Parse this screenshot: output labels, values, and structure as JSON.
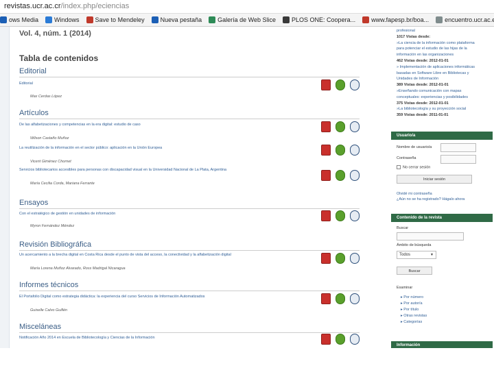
{
  "browser": {
    "url_host": "revistas.ucr.ac.cr",
    "url_path": "/index.php/eciencias",
    "bookmarks": [
      {
        "label": "ows Media",
        "color": "#1c5fb5"
      },
      {
        "label": "Windows",
        "color": "#2b7bd6"
      },
      {
        "label": "Save to Mendeley",
        "color": "#c0392b"
      },
      {
        "label": "Nueva pestaña",
        "color": "#1c5fb5"
      },
      {
        "label": "Galería de Web Slice",
        "color": "#2e8b57"
      },
      {
        "label": "PLOS ONE: Coopera...",
        "color": "#3a3a3a"
      },
      {
        "label": "www.fapesp.br/boa...",
        "color": "#c0392b"
      },
      {
        "label": "encuentro.ucr.ac.ed...",
        "color": "#7f8c8d"
      }
    ]
  },
  "issue": {
    "volume": "Vol. 4, núm. 1 (2014)",
    "toc_title": "Tabla de contenidos"
  },
  "sections": [
    {
      "title": "Editorial",
      "articles": [
        {
          "title": "Editorial",
          "authors": "Max Cerdas López"
        }
      ]
    },
    {
      "title": "Artículos",
      "articles": [
        {
          "title": "De las alfabetizaciones y competencias en la era digital: estudio de caso",
          "authors": "Wilson Castaño Muñoz"
        },
        {
          "title": "La reutilización de la información en el sector público: aplicación en la Unión Europea",
          "authors": "Vicent Giménez Chornet"
        },
        {
          "title": "Servicios bibliotecarios accesibles para personas con discapacidad visual en la Universidad Nacional de La Plata, Argentina",
          "authors": "María Cecilia Corda, Mariana Ferrante"
        }
      ]
    },
    {
      "title": "Ensayos",
      "articles": [
        {
          "title": "Con el estratégico de gestión en unidades de información",
          "authors": "Myron Fernández Méndez"
        }
      ]
    },
    {
      "title": "Revisión Bibliográfica",
      "articles": [
        {
          "title": "Un acercamiento a la brecha digital en Costa Rica desde el punto de vista del acceso, la conectividad y la alfabetización digital",
          "authors": "María Lorena Muñoz Alvarado, Ross Madrigal Nicaragua"
        }
      ]
    },
    {
      "title": "Informes técnicos",
      "articles": [
        {
          "title": "El Portafolio Digital como estrategia didáctica: la experiencia del curso Servicios de Información Automatizados",
          "authors": "Guiselle Calvo Guillén"
        }
      ]
    },
    {
      "title": "Misceláneas",
      "articles": [
        {
          "title": "Notificación Año 2014 en Escuela de Bibliotecología y Ciencias de la Información",
          "authors": ""
        }
      ]
    }
  ],
  "format_icons": {
    "pdf": "PDF",
    "epub": "EPUB",
    "html": "HTML"
  },
  "sidebar": {
    "popular": [
      {
        "text": "profesional",
        "style": "link"
      },
      {
        "text": "1017 Vistas desde:",
        "style": "bold"
      },
      {
        "text": "»La ciencia de la información como plataforma",
        "style": "link"
      },
      {
        "text": "para potenciar el estudio de las hijas de la",
        "style": "link"
      },
      {
        "text": "información en las organizaciones",
        "style": "link"
      },
      {
        "text": "462 Vistas desde: 2012-01-01",
        "style": "bold"
      },
      {
        "text": "» Implementación de aplicaciones informáticas",
        "style": "link"
      },
      {
        "text": "basadas en Software Libre en Bibliotecas y",
        "style": "link"
      },
      {
        "text": "Unidades de Información",
        "style": "link"
      },
      {
        "text": "389 Vistas desde: 2012-01-01",
        "style": "bold"
      },
      {
        "text": "»Enseñando comunicación con mapas",
        "style": "link"
      },
      {
        "text": "conceptuales: experiencias y posibilidades",
        "style": "link"
      },
      {
        "text": "375 Vistas desde: 2012-01-01",
        "style": "bold"
      },
      {
        "text": "»La bibliotecología y su proyección social",
        "style": "link"
      },
      {
        "text": "359 Vistas desde: 2011-01-01",
        "style": "bold"
      }
    ],
    "user_block": {
      "heading": "Usuario/a",
      "username_label": "Nombre de usuario/a",
      "password_label": "Contraseña",
      "remember_label": "No cerrar sesión",
      "login_button": "Iniciar sesión",
      "forgot": "Olvidé mi contraseña",
      "register": "¿Aún no se ha registrado? Hágalo ahora"
    },
    "journal_block": {
      "heading": "Contenido de la revista",
      "search_label": "Buscar",
      "scope_label": "Ámbito de búsqueda",
      "scope_value": "Todos",
      "search_button": "Buscar",
      "browse_label": "Examinar",
      "browse_items": [
        "Por número",
        "Por autor/a",
        "Por título",
        "Otras revistas",
        "Categorías"
      ]
    },
    "info_heading": "Información"
  }
}
